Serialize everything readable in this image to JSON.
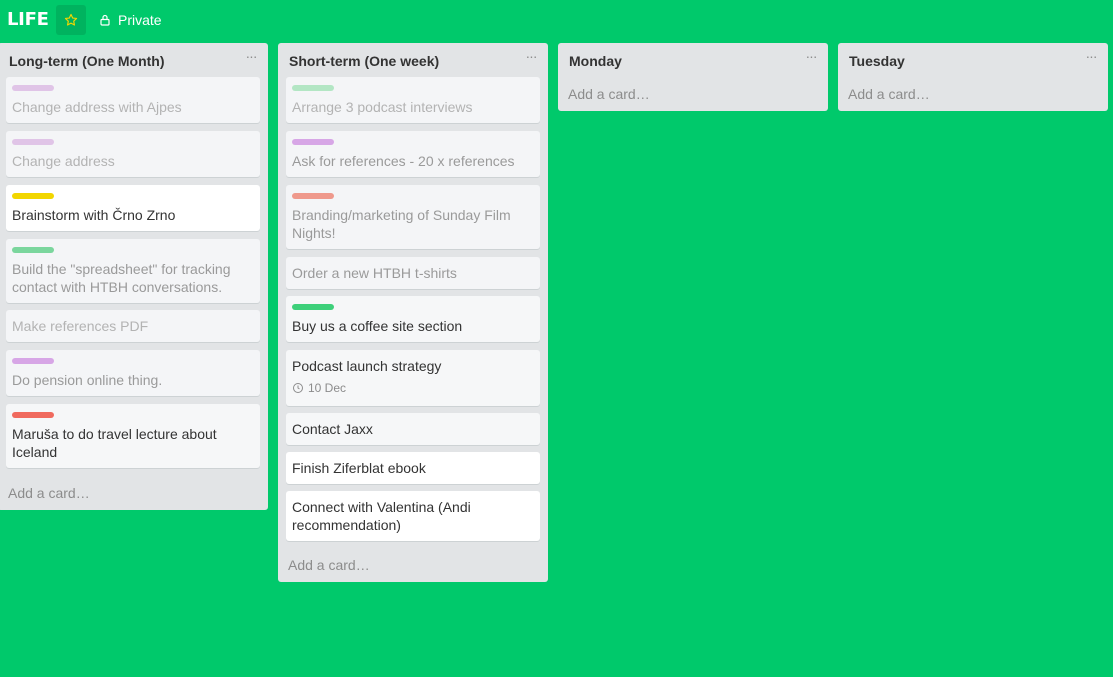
{
  "board": {
    "title": "LIFE",
    "privacy": "Private",
    "star_icon": "star-icon",
    "lock_icon": "lock-icon"
  },
  "colors": {
    "background": "#00c96b",
    "list_bg": "#e2e4e6",
    "label_purple": "#d8b4e2",
    "label_purple_strong": "#d7a6e6",
    "label_yellow": "#f2d600",
    "label_green": "#7bd69d",
    "label_green_strong": "#3ed07a",
    "label_green_light": "#b3e6c4",
    "label_red": "#f06a5e",
    "label_salmon": "#ef998c"
  },
  "lists": [
    {
      "title": "Long-term (One Month)",
      "menu": "···",
      "add_card": "Add a card…",
      "cards": [
        {
          "text": "Change address with Ajpes",
          "label": "#e0c4e7"
        },
        {
          "text": "Change address",
          "label": "#e0c4e7"
        },
        {
          "text": "Brainstorm with Črno Zrno",
          "label": "#f2d600"
        },
        {
          "text": "Build the \"spreadsheet\" for tracking contact with HTBH conversations.",
          "label": "#7bd69d"
        },
        {
          "text": "Make references PDF",
          "label": ""
        },
        {
          "text": "Do pension online thing.",
          "label": "#d7a6e6"
        },
        {
          "text": "Maruša to do travel lecture about Iceland",
          "label": "#f06a5e"
        }
      ]
    },
    {
      "title": "Short-term (One week)",
      "menu": "···",
      "add_card": "Add a card…",
      "cards": [
        {
          "text": "Arrange 3 podcast interviews",
          "label": "#b3e6c4"
        },
        {
          "text": "Ask for references - 20 x references",
          "label": "#d7a6e6"
        },
        {
          "text": "Branding/marketing of Sunday Film Nights!",
          "label": "#ef998c"
        },
        {
          "text": "Order a new HTBH t-shirts",
          "label": ""
        },
        {
          "text": "Buy us a coffee site section",
          "label": "#3ed07a"
        },
        {
          "text": "Podcast launch strategy",
          "label": "",
          "due": "10 Dec"
        },
        {
          "text": "Contact Jaxx",
          "label": ""
        },
        {
          "text": "Finish Ziferblat ebook",
          "label": ""
        },
        {
          "text": "Connect with Valentina (Andi recommendation)",
          "label": ""
        }
      ]
    },
    {
      "title": "Monday",
      "menu": "···",
      "add_card": "Add a card…",
      "cards": []
    },
    {
      "title": "Tuesday",
      "menu": "···",
      "add_card": "Add a card…",
      "cards": []
    }
  ]
}
